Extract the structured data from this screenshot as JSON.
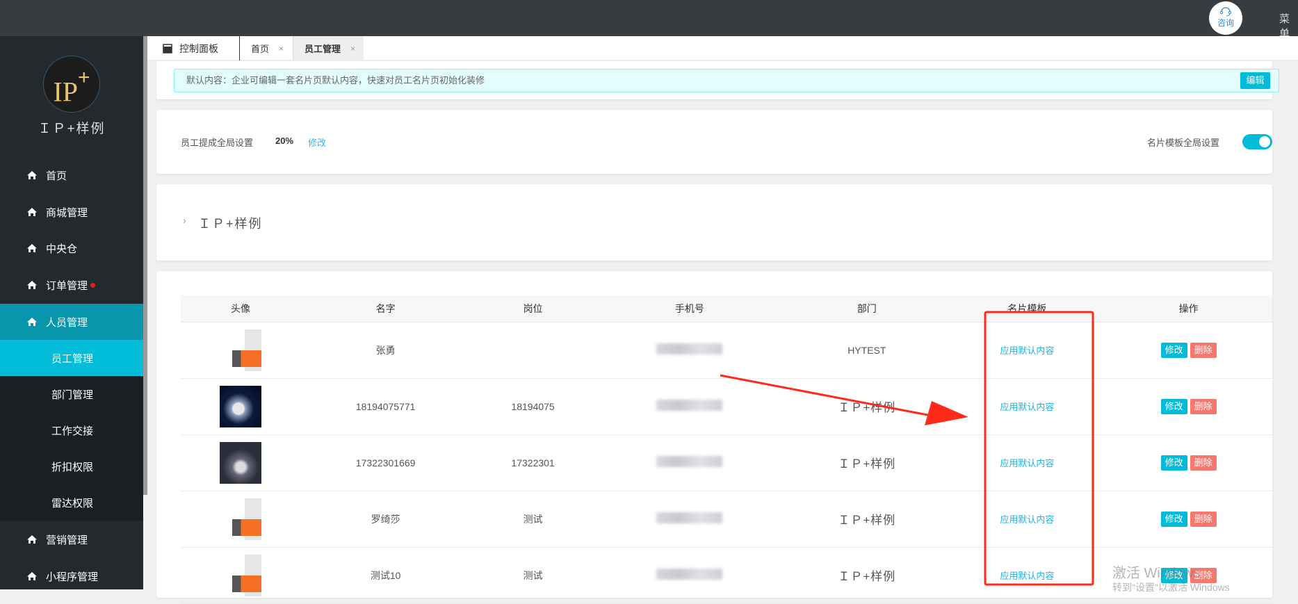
{
  "topbar": {
    "consult_label": "咨询",
    "menu_label": "菜单"
  },
  "sidebar": {
    "brand": "ＩＰ+样例",
    "logo_text": "IP",
    "items": [
      {
        "label": "首页"
      },
      {
        "label": "商城管理"
      },
      {
        "label": "中央仓"
      },
      {
        "label": "订单管理"
      },
      {
        "label": "人员管理"
      },
      {
        "label": "员工管理"
      },
      {
        "label": "部门管理"
      },
      {
        "label": "工作交接"
      },
      {
        "label": "折扣权限"
      },
      {
        "label": "雷达权限"
      },
      {
        "label": "营销管理"
      },
      {
        "label": "小程序管理"
      }
    ]
  },
  "tabs": [
    {
      "label": "控制面板"
    },
    {
      "label": "首页"
    },
    {
      "label": "员工管理"
    }
  ],
  "notice": {
    "text": "默认内容：企业可编辑一套名片页默认内容，快速对员工名片页初始化装修",
    "edit_label": "编辑"
  },
  "settings": {
    "commission_label": "员工提成全局设置",
    "commission_value": "20%",
    "modify_label": "修改",
    "template_label": "名片模板全局设置",
    "template_enabled": true
  },
  "org": {
    "name": "ＩＰ+样例"
  },
  "table": {
    "headers": [
      "头像",
      "名字",
      "岗位",
      "手机号",
      "部门",
      "名片模板",
      "操作"
    ],
    "rows": [
      {
        "name": "张勇",
        "position": "",
        "dept": "HYTEST",
        "template": "应用默认内容"
      },
      {
        "name": "18194075771",
        "position": "18194075",
        "dept": "ＩＰ+样例",
        "template": "应用默认内容"
      },
      {
        "name": "17322301669",
        "position": "17322301",
        "dept": "ＩＰ+样例",
        "template": "应用默认内容"
      },
      {
        "name": "罗绮莎",
        "position": "测试",
        "dept": "ＩＰ+样例",
        "template": "应用默认内容"
      },
      {
        "name": "测试10",
        "position": "测试",
        "dept": "ＩＰ+样例",
        "template": "应用默认内容"
      }
    ],
    "edit_label": "修改",
    "delete_label": "删除"
  },
  "watermark": {
    "line1": "激活 Windows",
    "line2": "转到\"设置\"以激活 Windows"
  },
  "colors": {
    "accent": "#00bcd9",
    "danger": "#f5776e",
    "annotation": "#ff2a1a"
  }
}
